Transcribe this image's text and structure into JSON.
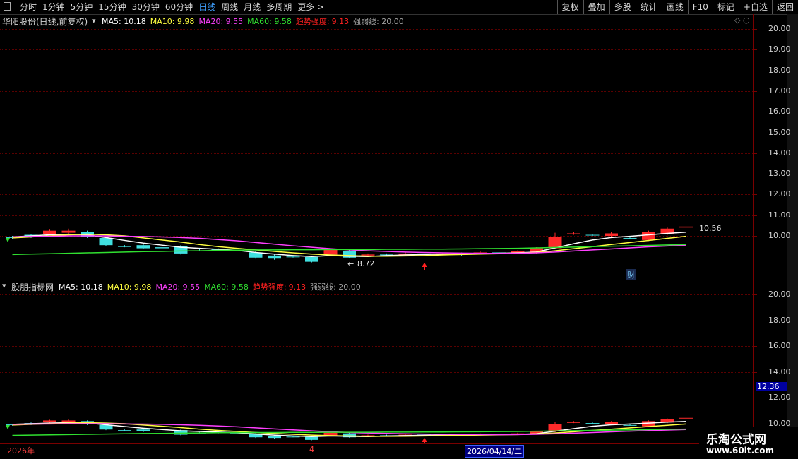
{
  "toolbar": {
    "periods": [
      "分时",
      "1分钟",
      "5分钟",
      "15分钟",
      "30分钟",
      "60分钟",
      "日线",
      "周线",
      "月线",
      "多周期",
      "更多 >"
    ],
    "active_period": "日线",
    "right_buttons": [
      "复权",
      "叠加",
      "多股",
      "统计",
      "画线",
      "F10",
      "标记",
      "+自选",
      "返回"
    ]
  },
  "main": {
    "title": "华阳股份(日线,前复权)",
    "ma": [
      {
        "label": "MA5: 10.18",
        "color": "#ffffff"
      },
      {
        "label": "MA10: 9.98",
        "color": "#ffff40"
      },
      {
        "label": "MA20: 9.55",
        "color": "#ff40ff"
      },
      {
        "label": "MA60: 9.58",
        "color": "#30e030"
      }
    ],
    "trend": {
      "label": "趋势强度:",
      "value": "9.13",
      "color": "#ff2020"
    },
    "strong_weak": "强弱线: 20.00",
    "yticks": [
      "20.00",
      "19.00",
      "18.00",
      "17.00",
      "16.00",
      "15.00",
      "14.00",
      "13.00",
      "12.00",
      "11.00",
      "10.00"
    ],
    "high_label": "10.56",
    "low_label": "8.72",
    "cai_badge": "财"
  },
  "sub": {
    "title": "股朋指标网",
    "ma": [
      {
        "label": "MA5: 10.18",
        "color": "#ffffff"
      },
      {
        "label": "MA10: 9.98",
        "color": "#ffff40"
      },
      {
        "label": "MA20: 9.55",
        "color": "#ff40ff"
      },
      {
        "label": "MA60: 9.58",
        "color": "#30e030"
      }
    ],
    "trend": {
      "label": "趋势强度:",
      "value": "9.13",
      "color": "#ff2020"
    },
    "strong_weak": "强弱线: 20.00",
    "yticks": [
      "20.00",
      "18.00",
      "16.00",
      "14.00",
      "12.00",
      "10.00"
    ],
    "cursor_value": "12.36"
  },
  "xaxis": {
    "year": "2026年",
    "month": "4",
    "cursor_date": "2026/04/14/二"
  },
  "watermark": {
    "line1": "乐淘公式网",
    "line2": "www.60lt.com"
  },
  "chart_data": {
    "type": "candlestick",
    "title": "华阳股份(日线,前复权)",
    "ylim": [
      8.5,
      20.3
    ],
    "candles": [
      {
        "o": 9.95,
        "c": 9.9,
        "h": 10.0,
        "l": 9.85
      },
      {
        "o": 10.05,
        "c": 9.95,
        "h": 10.1,
        "l": 9.9
      },
      {
        "o": 10.1,
        "c": 10.25,
        "h": 10.3,
        "l": 10.05
      },
      {
        "o": 10.15,
        "c": 10.25,
        "h": 10.35,
        "l": 10.1
      },
      {
        "o": 10.2,
        "c": 9.95,
        "h": 10.25,
        "l": 9.9
      },
      {
        "o": 9.9,
        "c": 9.55,
        "h": 9.95,
        "l": 9.5
      },
      {
        "o": 9.5,
        "c": 9.48,
        "h": 9.55,
        "l": 9.45
      },
      {
        "o": 9.55,
        "c": 9.4,
        "h": 9.6,
        "l": 9.35
      },
      {
        "o": 9.45,
        "c": 9.4,
        "h": 9.5,
        "l": 9.35
      },
      {
        "o": 9.5,
        "c": 9.15,
        "h": 9.55,
        "l": 9.1
      },
      {
        "o": 9.3,
        "c": 9.28,
        "h": 9.35,
        "l": 9.25
      },
      {
        "o": 9.35,
        "c": 9.3,
        "h": 9.4,
        "l": 9.25
      },
      {
        "o": 9.3,
        "c": 9.25,
        "h": 9.35,
        "l": 9.2
      },
      {
        "o": 9.2,
        "c": 8.95,
        "h": 9.25,
        "l": 8.9
      },
      {
        "o": 9.05,
        "c": 8.9,
        "h": 9.1,
        "l": 8.85
      },
      {
        "o": 9.0,
        "c": 8.98,
        "h": 9.05,
        "l": 8.95
      },
      {
        "o": 8.98,
        "c": 8.75,
        "h": 9.0,
        "l": 8.72
      },
      {
        "o": 9.1,
        "c": 9.35,
        "h": 9.4,
        "l": 9.05
      },
      {
        "o": 9.25,
        "c": 8.95,
        "h": 9.3,
        "l": 8.92
      },
      {
        "o": 9.05,
        "c": 9.1,
        "h": 9.15,
        "l": 9.0
      },
      {
        "o": 9.1,
        "c": 9.08,
        "h": 9.15,
        "l": 9.05
      },
      {
        "o": 9.08,
        "c": 9.15,
        "h": 9.2,
        "l": 9.05
      },
      {
        "o": 9.15,
        "c": 9.12,
        "h": 9.2,
        "l": 9.1
      },
      {
        "o": 9.12,
        "c": 9.15,
        "h": 9.2,
        "l": 9.1
      },
      {
        "o": 9.15,
        "c": 9.1,
        "h": 9.2,
        "l": 9.05
      },
      {
        "o": 9.15,
        "c": 9.2,
        "h": 9.25,
        "l": 9.1
      },
      {
        "o": 9.2,
        "c": 9.18,
        "h": 9.25,
        "l": 9.15
      },
      {
        "o": 9.2,
        "c": 9.25,
        "h": 9.3,
        "l": 9.15
      },
      {
        "o": 9.2,
        "c": 9.4,
        "h": 9.45,
        "l": 9.15
      },
      {
        "o": 9.4,
        "c": 9.95,
        "h": 10.15,
        "l": 9.35
      },
      {
        "o": 10.1,
        "c": 10.12,
        "h": 10.2,
        "l": 10.05
      },
      {
        "o": 10.05,
        "c": 10.02,
        "h": 10.1,
        "l": 10.0
      },
      {
        "o": 10.0,
        "c": 10.12,
        "h": 10.2,
        "l": 9.95
      },
      {
        "o": 9.9,
        "c": 9.88,
        "h": 9.95,
        "l": 9.85
      },
      {
        "o": 9.8,
        "c": 10.2,
        "h": 10.25,
        "l": 9.75
      },
      {
        "o": 10.1,
        "c": 10.35,
        "h": 10.4,
        "l": 10.05
      },
      {
        "o": 10.4,
        "c": 10.45,
        "h": 10.56,
        "l": 10.35
      }
    ],
    "series": [
      {
        "name": "MA5",
        "color": "#ffffff",
        "values": [
          9.95,
          10.0,
          10.05,
          10.08,
          10.05,
          9.92,
          9.78,
          9.65,
          9.55,
          9.45,
          9.4,
          9.35,
          9.3,
          9.2,
          9.12,
          9.05,
          9.0,
          9.05,
          9.02,
          9.0,
          9.05,
          9.08,
          9.1,
          9.12,
          9.13,
          9.14,
          9.16,
          9.18,
          9.22,
          9.42,
          9.62,
          9.8,
          9.92,
          9.98,
          10.05,
          10.12,
          10.18
        ]
      },
      {
        "name": "MA10",
        "color": "#ffff40",
        "values": [
          9.9,
          9.95,
          10.0,
          10.05,
          10.08,
          10.05,
          10.0,
          9.9,
          9.8,
          9.7,
          9.58,
          9.48,
          9.4,
          9.32,
          9.25,
          9.18,
          9.12,
          9.08,
          9.05,
          9.02,
          9.02,
          9.03,
          9.05,
          9.08,
          9.1,
          9.12,
          9.14,
          9.16,
          9.2,
          9.28,
          9.38,
          9.48,
          9.58,
          9.68,
          9.78,
          9.88,
          9.98
        ]
      },
      {
        "name": "MA20",
        "color": "#ff40ff",
        "values": [
          9.95,
          9.97,
          9.98,
          10.0,
          10.0,
          10.0,
          9.98,
          9.97,
          9.95,
          9.92,
          9.88,
          9.82,
          9.76,
          9.68,
          9.6,
          9.52,
          9.45,
          9.38,
          9.32,
          9.28,
          9.25,
          9.22,
          9.2,
          9.18,
          9.17,
          9.16,
          9.15,
          9.16,
          9.18,
          9.22,
          9.27,
          9.32,
          9.37,
          9.42,
          9.47,
          9.51,
          9.55
        ]
      },
      {
        "name": "MA60",
        "color": "#30e030",
        "values": [
          9.1,
          9.12,
          9.14,
          9.16,
          9.18,
          9.2,
          9.22,
          9.24,
          9.25,
          9.27,
          9.28,
          9.3,
          9.31,
          9.32,
          9.32,
          9.33,
          9.33,
          9.34,
          9.34,
          9.34,
          9.35,
          9.35,
          9.36,
          9.36,
          9.37,
          9.38,
          9.39,
          9.4,
          9.42,
          9.44,
          9.46,
          9.48,
          9.5,
          9.52,
          9.54,
          9.56,
          9.58
        ]
      }
    ]
  }
}
